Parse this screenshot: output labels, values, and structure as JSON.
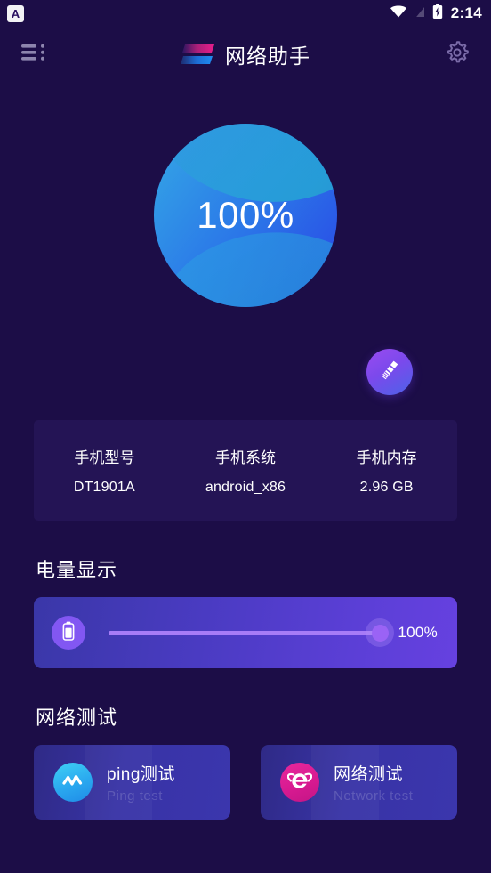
{
  "status_bar": {
    "app_badge_letter": "A",
    "wifi_icon": "wifi-icon",
    "signal_icon": "signal-off-icon",
    "battery_icon": "battery-charging-icon",
    "time": "2:14"
  },
  "app_bar": {
    "menu_icon": "list-menu-icon",
    "logo_icon": "brand-logo-icon",
    "title": "网络助手",
    "settings_icon": "gear-icon"
  },
  "gauge": {
    "value_label": "100%",
    "percent": 100,
    "gradient_start": "#2f9fe8",
    "gradient_end": "#2b52e6"
  },
  "clean_button": {
    "icon": "broom-icon",
    "gradient_start": "#9a4bf0",
    "gradient_end": "#4c63e8"
  },
  "device_info": {
    "columns": [
      {
        "label": "手机型号",
        "value": "DT1901A"
      },
      {
        "label": "手机系统",
        "value": "android_x86"
      },
      {
        "label": "手机内存",
        "value": "2.96 GB"
      }
    ]
  },
  "battery_section": {
    "heading": "电量显示",
    "icon": "battery-icon",
    "percent": 100,
    "percent_label": "100%",
    "accent": "#9a63f5"
  },
  "network_section": {
    "heading": "网络测试",
    "cards": [
      {
        "icon": "pulse-icon",
        "title": "ping测试",
        "subtitle": "Ping test",
        "accent": "#2aa8ef"
      },
      {
        "icon": "internet-explorer-icon",
        "title": "网络测试",
        "subtitle": "Network test",
        "accent": "#d81a91"
      }
    ]
  },
  "theme": {
    "background": "#1c0d47",
    "card_background": "#241455"
  }
}
